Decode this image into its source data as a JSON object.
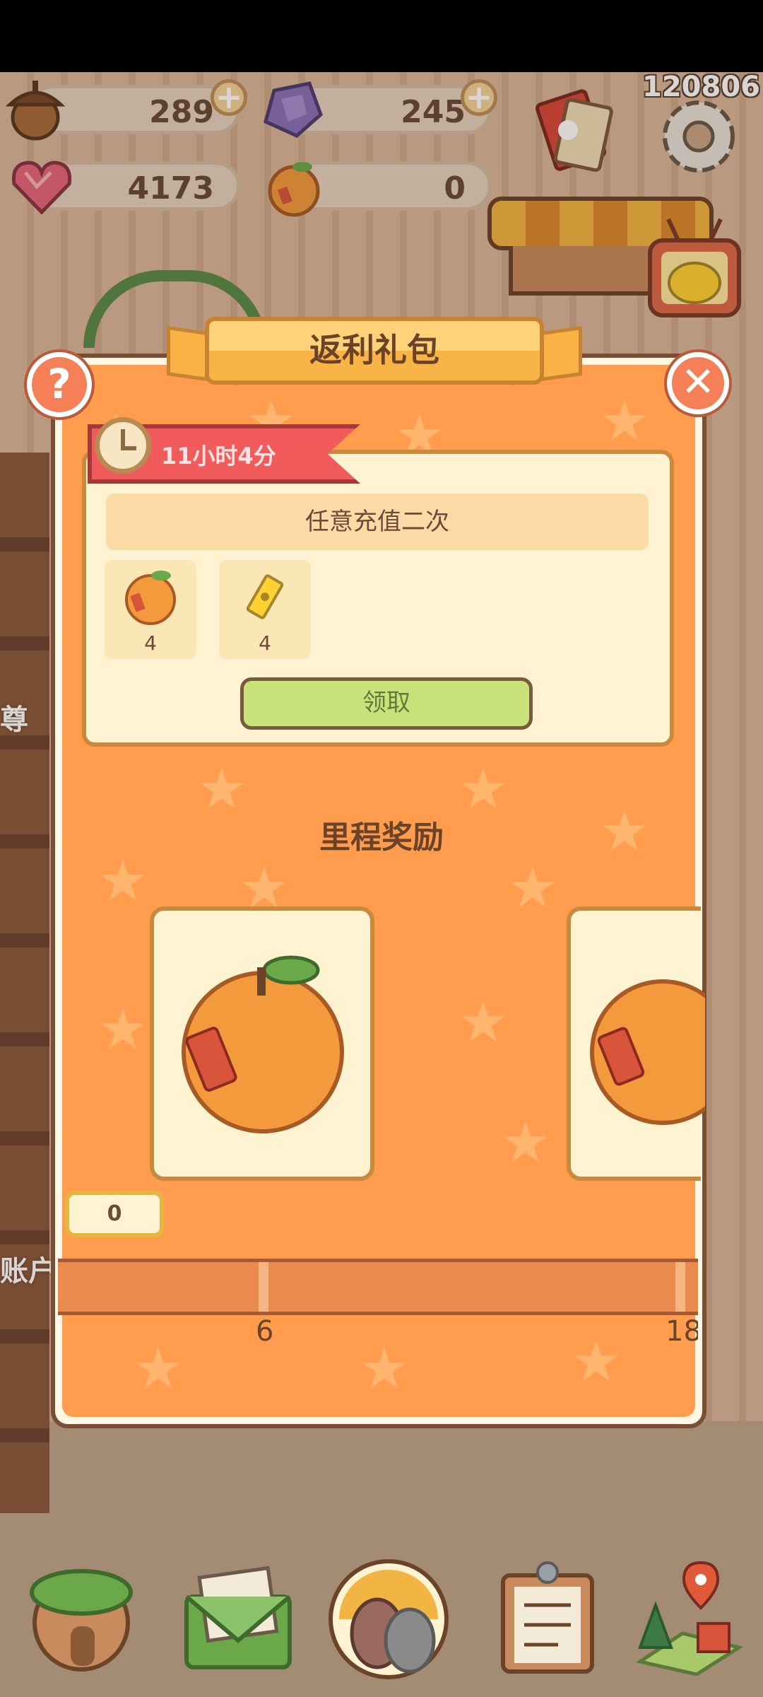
{
  "status_bar": {},
  "resources": {
    "acorn": {
      "icon": "acorn-icon",
      "value": "289"
    },
    "gem": {
      "icon": "purple-gem-icon",
      "value": "245"
    },
    "heart": {
      "icon": "heart-gem-icon",
      "value": "4173"
    },
    "orange": {
      "icon": "orange-icon",
      "value": "0"
    }
  },
  "user_id": "120806",
  "background": {
    "shelf_text_1": "尊",
    "shelf_text_2": "账户"
  },
  "popup": {
    "title": "返利礼包",
    "help_label": "?",
    "close_label": "✕",
    "timer": "11小时4分",
    "task": "任意充值二次",
    "rewards": [
      {
        "icon": "orange-icon",
        "count": "4"
      },
      {
        "icon": "ticket-icon",
        "count": "4"
      }
    ],
    "claim_label": "领取",
    "milestone_title": "里程奖励",
    "progress_value": "0",
    "milestones": [
      "6",
      "18"
    ]
  },
  "colors": {
    "popup_bg": "#ff9c4e",
    "card_bg": "#fff3d2",
    "claim_green": "#c9e27a",
    "timer_red": "#f25b5b"
  },
  "dock": [
    {
      "name": "house-icon"
    },
    {
      "name": "mail-icon"
    },
    {
      "name": "gacha-icon"
    },
    {
      "name": "clipboard-icon"
    },
    {
      "name": "map-icon"
    }
  ]
}
